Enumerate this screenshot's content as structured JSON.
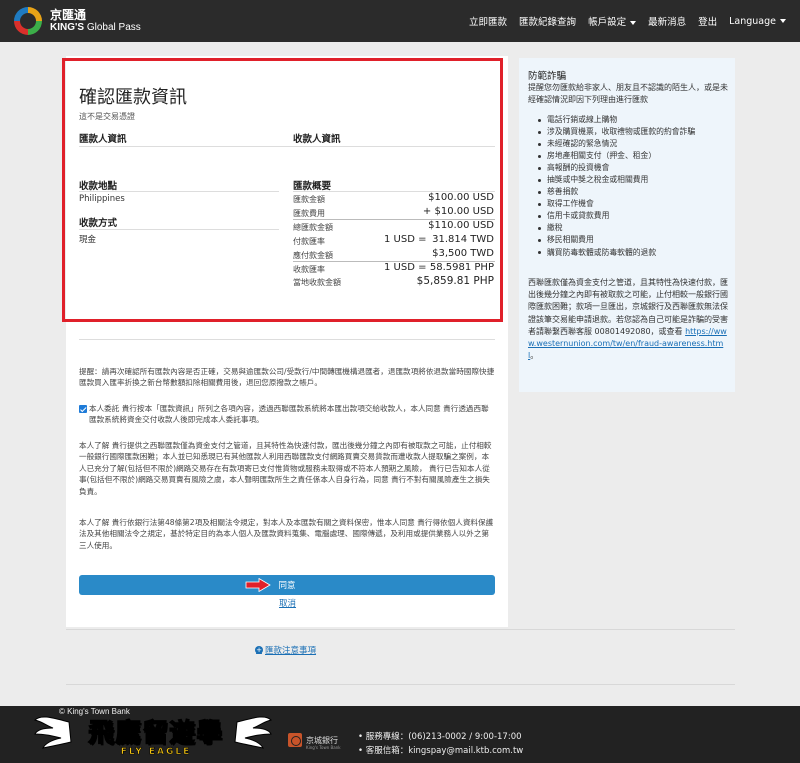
{
  "brand": {
    "name_cn": "京匯通",
    "name_en_bold": "KING'S",
    "name_en_rest": " Global Pass"
  },
  "nav": {
    "items": [
      "立即匯款",
      "匯款紀錄查詢",
      "帳戶設定",
      "最新消息",
      "登出",
      "Language"
    ]
  },
  "confirm": {
    "title": "確認匯款資訊",
    "subtitle": "這不是交易憑證",
    "remitter_head": "匯款人資訊",
    "payee_head": "收款人資訊",
    "location_head": "收款地點",
    "location_value": "Philippines",
    "method_head": "收款方式",
    "method_value": "現金",
    "summary_head": "匯款概要",
    "rows": [
      {
        "label": "匯款金額",
        "mid": "",
        "value": "$100.00 USD"
      },
      {
        "label": "匯款費用",
        "mid": "",
        "value": "+ $10.00 USD"
      },
      {
        "label": "總匯款金額",
        "mid": "",
        "value": "$110.00 USD"
      },
      {
        "label": "付款匯率",
        "mid": "1 USD =",
        "value": "31.814 TWD"
      },
      {
        "label": "應付款金額",
        "mid": "",
        "value": "$3,500 TWD"
      },
      {
        "label": "收款匯率",
        "mid": "1 USD =",
        "value": "58.5981 PHP"
      },
      {
        "label": "當地收款金額",
        "mid": "",
        "value": "$5,859.81 PHP"
      }
    ]
  },
  "notices": {
    "reminder": "提醒：請再次確認所有匯款內容是否正確，交易與逾匯款公司/受款行/中間轉匯機構退匯者，退匯款項將依退款當時國際快捷匯款買入匯率折換之新台幣數額扣除相關費用後，退回您原撥款之帳戶。",
    "consent": "本人委託 貴行按本「匯款資訊」所列之各項內容，透過西聯匯款系統將本匯出款項交給收款人，本人同意 貴行透過西聯匯款系統將資金交付收款人後即完成本人委託事項。",
    "understand1": "本人了解 貴行提供之西聯匯款僅為資金支付之管道，且其特性為快速付款，匯出後幾分鐘之內即有被取款之可能，止付相較一般銀行國際匯款困難；本人並已知悉現已有其他匯款人利用西聯匯款支付網路買賣交易貨款而遭收款人提取騙之案例，本人已充分了解(包括但不限於)網路交易存在有款項寄已支付惟貨物或服務未取得或不符本人預期之風險， 貴行已告知本人從事(包括但不限於)網路交易買賣有風險之虞，本人聲明匯款所生之責任係本人自身行為，同意 貴行不對有關風險產生之損失負責。",
    "understand2": "本人了解 貴行依銀行法第48條第2項及相關法令規定，對本人及本匯款有關之資料保密，惟本人同意 貴行得依個人資料保護法及其他相關法令之規定，基於特定目的為本人個人及匯款資料蒐集、電腦處理、國際傳遞，及利用或提供業務人以外之第三人使用。"
  },
  "actions": {
    "agree": "同意",
    "cancel": "取消",
    "notes_link": "匯款注意事項",
    "notes_icon": "plus-circle-icon"
  },
  "sidebar": {
    "title": "防範詐騙",
    "intro": "提醒您勿匯款給非家人、朋友且不認識的陌生人，或是未經確認情況即因下列理由進行匯款",
    "items": [
      "電話行銷或線上購物",
      "涉及購買機票，收取禮物或匯款的約會詐騙",
      "未經確認的緊急情況",
      "房地產相關支付（押金、租金）",
      "高報酬的投資機會",
      "抽獎或中獎之稅金或相關費用",
      "慈善捐款",
      "取得工作機會",
      "信用卡或貸款費用",
      "繳稅",
      "移民相關費用",
      "購買防毒軟體或防毒軟體的退款"
    ],
    "body": "西聯匯款僅為資金支付之管道，且其特性為快速付款，匯出後幾分鐘之內即有被取款之可能，止付相較一般銀行國際匯款困難；款項一旦匯出，京城銀行及西聯匯款無法保證該筆交易能申請退款。若您認為自己可能是詐騙的受害者請聯繫西聯客服 00801492080，或查看",
    "link": "https://www.westernunion.com/tw/en/fraud-awareness.html",
    "link_tail": "。"
  },
  "footer": {
    "copyright": "© King's Town Bank",
    "watermark": "飛鷹留遊學",
    "watermark_sub": "FLY EAGLE",
    "bank_name": "京城銀行",
    "bank_sub": "King's Town Bank",
    "service": "• 服務專線：(06)213-0002 / 9:00-17:00",
    "email": "• 客服信箱：kingspay@mail.ktb.com.tw"
  },
  "colors": {
    "navbar": "#2b2b2b",
    "highlight_border": "#e0202a",
    "primary_button": "#2a8ac8",
    "link": "#1a6fb5",
    "sidebar_bg": "#eef5fb"
  }
}
